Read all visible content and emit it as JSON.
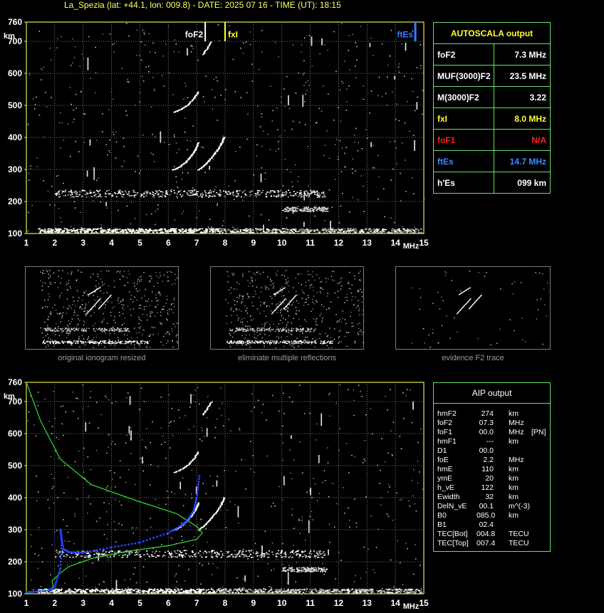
{
  "header": {
    "title": "La_Spezia (lat: +44.1, lon: 009.8) - DATE: 2025 07 16 - TIME (UT): 18:15"
  },
  "colors": {
    "axis_frame": "#e6e64d",
    "panel_border": "#6fdc6f",
    "foF2_marker": "#ffffff",
    "fxI_marker": "#ffff33",
    "ftEs_marker": "#3a7bff",
    "green_profile": "#33dd33",
    "blue_trace": "#2244ff"
  },
  "chart_data": [
    {
      "type": "scatter",
      "xlabel": "MHz",
      "ylabel": "km",
      "xlim": [
        1,
        15
      ],
      "ylim": [
        100,
        760
      ],
      "x_ticks": [
        "1",
        "2",
        "3",
        "4",
        "5",
        "6",
        "7",
        "8",
        "9",
        "10",
        "11",
        "12",
        "13",
        "14",
        "15"
      ],
      "y_ticks": [
        "100",
        "200",
        "300",
        "400",
        "500",
        "600",
        "700",
        "760"
      ],
      "grid": true,
      "markers": [
        {
          "label": "foF2",
          "x": 7.3
        },
        {
          "label": "fxI",
          "x": 8.0
        },
        {
          "label": "ftEs",
          "x": 14.7
        }
      ],
      "traces": {
        "o_F_trace": [
          [
            6.15,
            300
          ],
          [
            6.4,
            310
          ],
          [
            6.6,
            325
          ],
          [
            6.8,
            345
          ],
          [
            6.95,
            365
          ],
          [
            7.05,
            385
          ]
        ],
        "x_F_trace": [
          [
            7.05,
            300
          ],
          [
            7.3,
            318
          ],
          [
            7.5,
            338
          ],
          [
            7.7,
            360
          ],
          [
            7.85,
            382
          ],
          [
            7.95,
            402
          ]
        ],
        "o_F_2hop": [
          [
            6.2,
            480
          ],
          [
            6.45,
            490
          ],
          [
            6.7,
            505
          ],
          [
            6.9,
            525
          ],
          [
            7.05,
            545
          ]
        ],
        "o_F_3hop": [
          [
            7.2,
            660
          ],
          [
            7.35,
            680
          ],
          [
            7.5,
            700
          ]
        ],
        "es_band": [
          [
            2.0,
            225
          ],
          [
            6.0,
            218
          ],
          [
            9.5,
            225
          ],
          [
            11.5,
            230
          ]
        ],
        "e_band": [
          [
            1.5,
            110
          ],
          [
            8.0,
            108
          ],
          [
            14.8,
            112
          ]
        ]
      }
    },
    {
      "type": "scatter",
      "xlabel": "MHz",
      "ylabel": "km",
      "xlim": [
        1,
        15
      ],
      "ylim": [
        100,
        760
      ],
      "x_ticks": [
        "1",
        "2",
        "3",
        "4",
        "5",
        "6",
        "7",
        "8",
        "9",
        "10",
        "11",
        "12",
        "13",
        "14",
        "15"
      ],
      "y_ticks": [
        "100",
        "200",
        "300",
        "400",
        "500",
        "600",
        "700",
        "760"
      ],
      "grid": true,
      "series": [
        {
          "values_green_profile": [
            [
              1.0,
              760
            ],
            [
              1.5,
              640
            ],
            [
              2.2,
              520
            ],
            [
              3.3,
              440
            ],
            [
              4.9,
              390
            ],
            [
              6.3,
              350
            ],
            [
              7.0,
              310
            ],
            [
              7.2,
              290
            ],
            [
              7.0,
              270
            ],
            [
              6.0,
              250
            ],
            [
              4.5,
              232
            ],
            [
              3.3,
              210
            ],
            [
              2.5,
              185
            ],
            [
              2.2,
              165
            ],
            [
              1.9,
              140
            ],
            [
              1.95,
              125
            ],
            [
              1.85,
              112
            ],
            [
              1.2,
              105
            ],
            [
              1.0,
              104
            ]
          ],
          "values_blue_trace": [
            [
              1.0,
              105
            ],
            [
              1.8,
              110
            ],
            [
              2.0,
              120
            ],
            [
              2.2,
              180
            ],
            [
              2.25,
              265
            ],
            [
              2.2,
              300
            ],
            [
              2.3,
              240
            ],
            [
              2.5,
              230
            ],
            [
              3.0,
              228
            ],
            [
              4.0,
              245
            ],
            [
              5.0,
              260
            ],
            [
              6.0,
              290
            ],
            [
              6.6,
              320
            ],
            [
              6.9,
              360
            ],
            [
              7.0,
              400
            ],
            [
              7.1,
              470
            ]
          ]
        }
      ]
    }
  ],
  "autoscala": {
    "header": "AUTOSCALA output",
    "rows": [
      {
        "key": "foF2",
        "value": "7.3 MHz",
        "key_color": "#ffffff",
        "value_color": "#ffffff"
      },
      {
        "key": "MUF(3000)F2",
        "value": "23.5 MHz",
        "key_color": "#ffffff",
        "value_color": "#ffffff"
      },
      {
        "key": "M(3000)F2",
        "value": "3.22",
        "key_color": "#ffffff",
        "value_color": "#ffffff"
      },
      {
        "key": "fxI",
        "value": "8.0 MHz",
        "key_color": "#ffff33",
        "value_color": "#ffff33"
      },
      {
        "key": "foF1",
        "value": "N/A",
        "key_color": "#ff2222",
        "value_color": "#ff2222"
      },
      {
        "key": "ftEs",
        "value": "14.7 MHz",
        "key_color": "#3a8bff",
        "value_color": "#3a8bff"
      },
      {
        "key": "h'Es",
        "value": "099     km",
        "key_color": "#ffffff",
        "value_color": "#ffffff"
      }
    ]
  },
  "thumbnails": [
    {
      "caption": "original ionogram resized"
    },
    {
      "caption": "eliminate multiple reflections"
    },
    {
      "caption": "evidence F2 trace"
    }
  ],
  "aip": {
    "header": "AIP output",
    "rows": [
      {
        "name": "hmF2",
        "value": "274",
        "unit": "km",
        "extra": ""
      },
      {
        "name": "foF2",
        "value": "07.3",
        "unit": "MHz",
        "extra": ""
      },
      {
        "name": "foF1",
        "value": "00.0",
        "unit": "MHz",
        "extra": "[PN]"
      },
      {
        "name": "hmF1",
        "value": "---",
        "unit": "km",
        "extra": ""
      },
      {
        "name": "D1",
        "value": "00.0",
        "unit": "",
        "extra": ""
      },
      {
        "name": "foE",
        "value": "2.2",
        "unit": "MHz",
        "extra": ""
      },
      {
        "name": "hmE",
        "value": "110",
        "unit": "km",
        "extra": ""
      },
      {
        "name": "ymE",
        "value": "20",
        "unit": "km",
        "extra": ""
      },
      {
        "name": "h_vE",
        "value": "122",
        "unit": "km",
        "extra": ""
      },
      {
        "name": "Ewidth",
        "value": "32",
        "unit": "km",
        "extra": ""
      },
      {
        "name": "DelN_vE",
        "value": "00.1",
        "unit": "m^(-3)",
        "extra": ""
      },
      {
        "name": "B0",
        "value": "085.0",
        "unit": "km",
        "extra": ""
      },
      {
        "name": "B1",
        "value": "02.4",
        "unit": "",
        "extra": ""
      },
      {
        "name": "TEC[Bot]",
        "value": "004.8",
        "unit": "TECU",
        "extra": ""
      },
      {
        "name": "TEC[Top]",
        "value": "007.4",
        "unit": "TECU",
        "extra": ""
      }
    ]
  }
}
